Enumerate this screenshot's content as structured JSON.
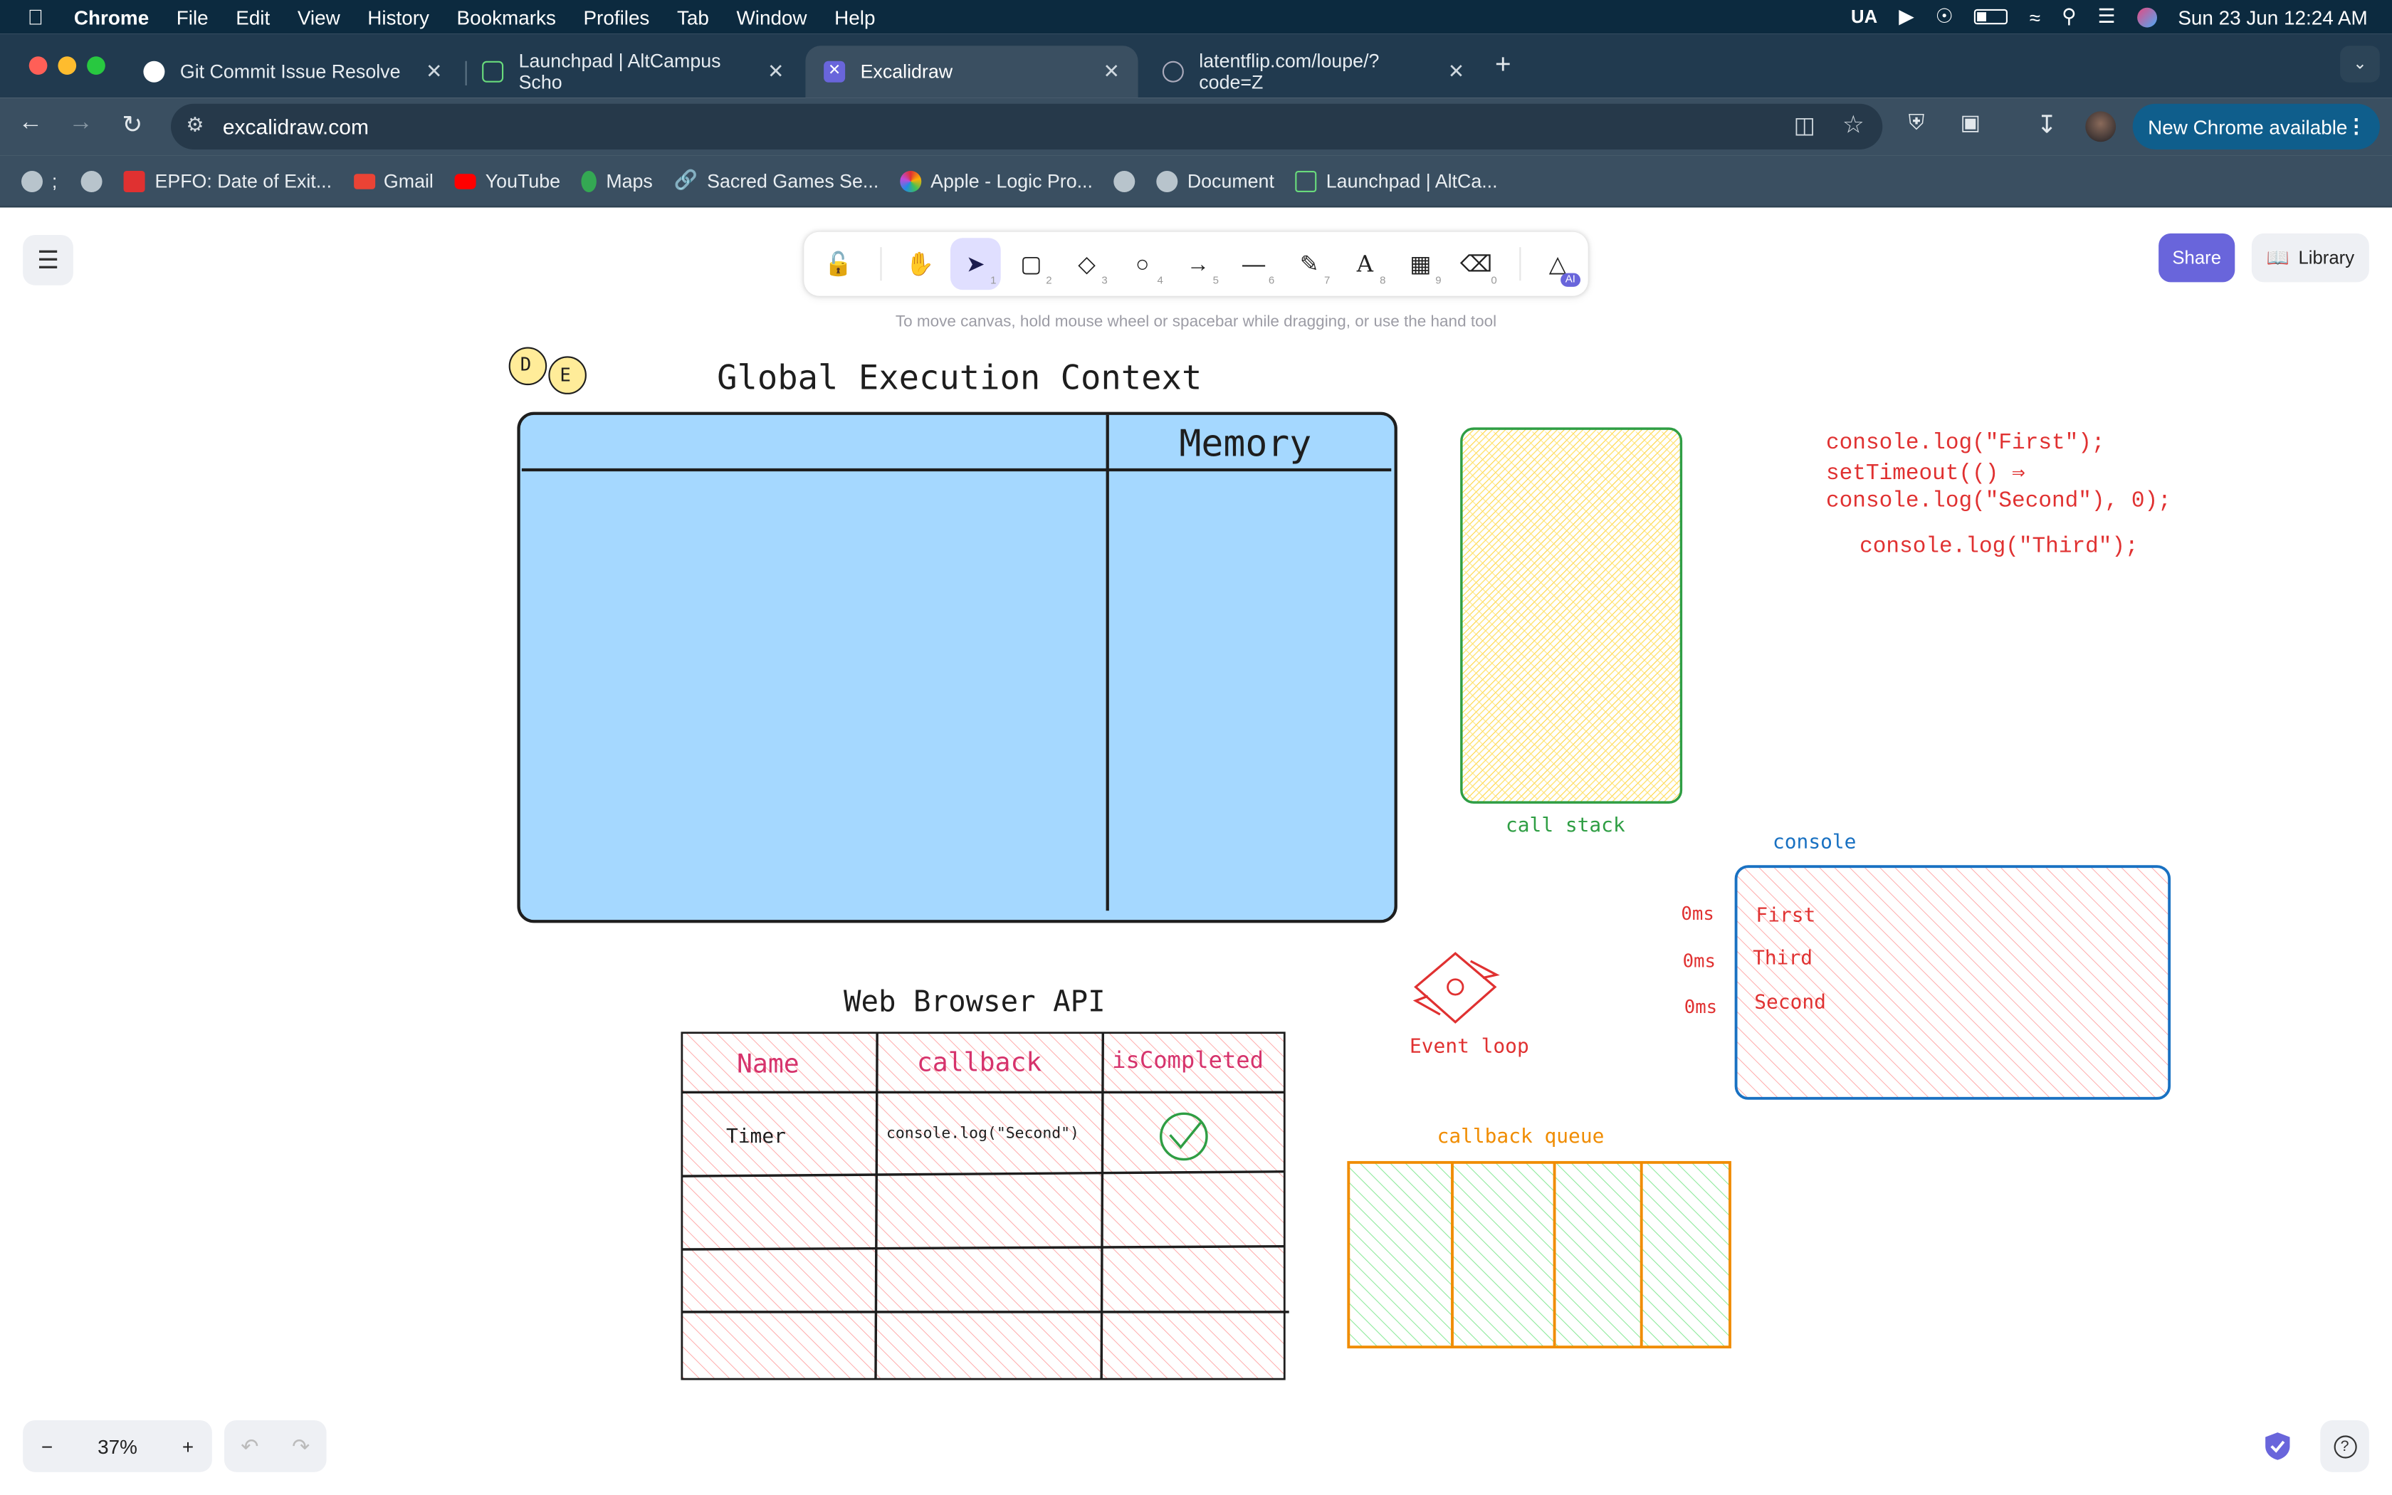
{
  "menubar": {
    "apple_icon": "apple-icon",
    "app": "Chrome",
    "items": [
      "File",
      "Edit",
      "View",
      "History",
      "Bookmarks",
      "Profiles",
      "Tab",
      "Window",
      "Help"
    ],
    "status": {
      "input": "UA",
      "datetime": "Sun 23 Jun  12:24 AM"
    }
  },
  "tabs": [
    {
      "title": "Git Commit Issue Resolve",
      "active": false
    },
    {
      "title": "Launchpad | AltCampus Scho",
      "active": false
    },
    {
      "title": "Excalidraw",
      "active": true
    },
    {
      "title": "latentflip.com/loupe/?code=Z",
      "active": false
    }
  ],
  "address_bar": {
    "url": "excalidraw.com",
    "update_label": "New Chrome available"
  },
  "bookmarks": [
    {
      "label": ";"
    },
    {
      "label": ""
    },
    {
      "label": "EPFO: Date of Exit..."
    },
    {
      "label": "Gmail"
    },
    {
      "label": "YouTube"
    },
    {
      "label": "Maps"
    },
    {
      "label": "Sacred Games Se..."
    },
    {
      "label": "Apple - Logic Pro..."
    },
    {
      "label": ""
    },
    {
      "label": "Document"
    },
    {
      "label": "Launchpad | AltCa..."
    }
  ],
  "excalidraw": {
    "toolbar_keys": [
      "1",
      "2",
      "3",
      "4",
      "5",
      "6",
      "7",
      "8",
      "9",
      "0"
    ],
    "ai_badge": "AI",
    "hint": "To move canvas, hold mouse wheel or spacebar while dragging, or use the hand tool",
    "share_label": "Share",
    "library_label": "Library",
    "zoom": "37%",
    "zoom_out": "−",
    "zoom_in": "+"
  },
  "drawing": {
    "collaborators": [
      "D",
      "E"
    ],
    "gec_title": "Global Execution Context",
    "memory_label": "Memory",
    "call_stack_label": "call stack",
    "code_lines": [
      "console.log(\"First\");",
      "setTimeout(() ⇒",
      "console.log(\"Second\"), 0);",
      "console.log(\"Third\");"
    ],
    "console_label": "console",
    "console_rows": [
      {
        "time": "0ms",
        "text": "First"
      },
      {
        "time": "0ms",
        "text": "Third"
      },
      {
        "time": "0ms",
        "text": "Second"
      }
    ],
    "event_loop_label": "Event loop",
    "web_api_title": "Web Browser API",
    "web_api_headers": [
      "Name",
      "callback",
      "isCompleted"
    ],
    "web_api_row": {
      "name": "Timer",
      "callback": "console.log(\"Second\")"
    },
    "callback_queue_label": "callback queue"
  },
  "colors": {
    "gec_fill": "#a5d8ff",
    "call_stack_stroke": "#2f9e44",
    "call_stack_hatch": "#ffec99",
    "code_red": "#e03131",
    "console_stroke": "#1971c2",
    "console_hatch": "#ffc9c9",
    "queue_stroke": "#f08c00",
    "queue_hatch": "#b2f2bb",
    "header_pink": "#d6336c",
    "share_purple": "#6965db"
  }
}
